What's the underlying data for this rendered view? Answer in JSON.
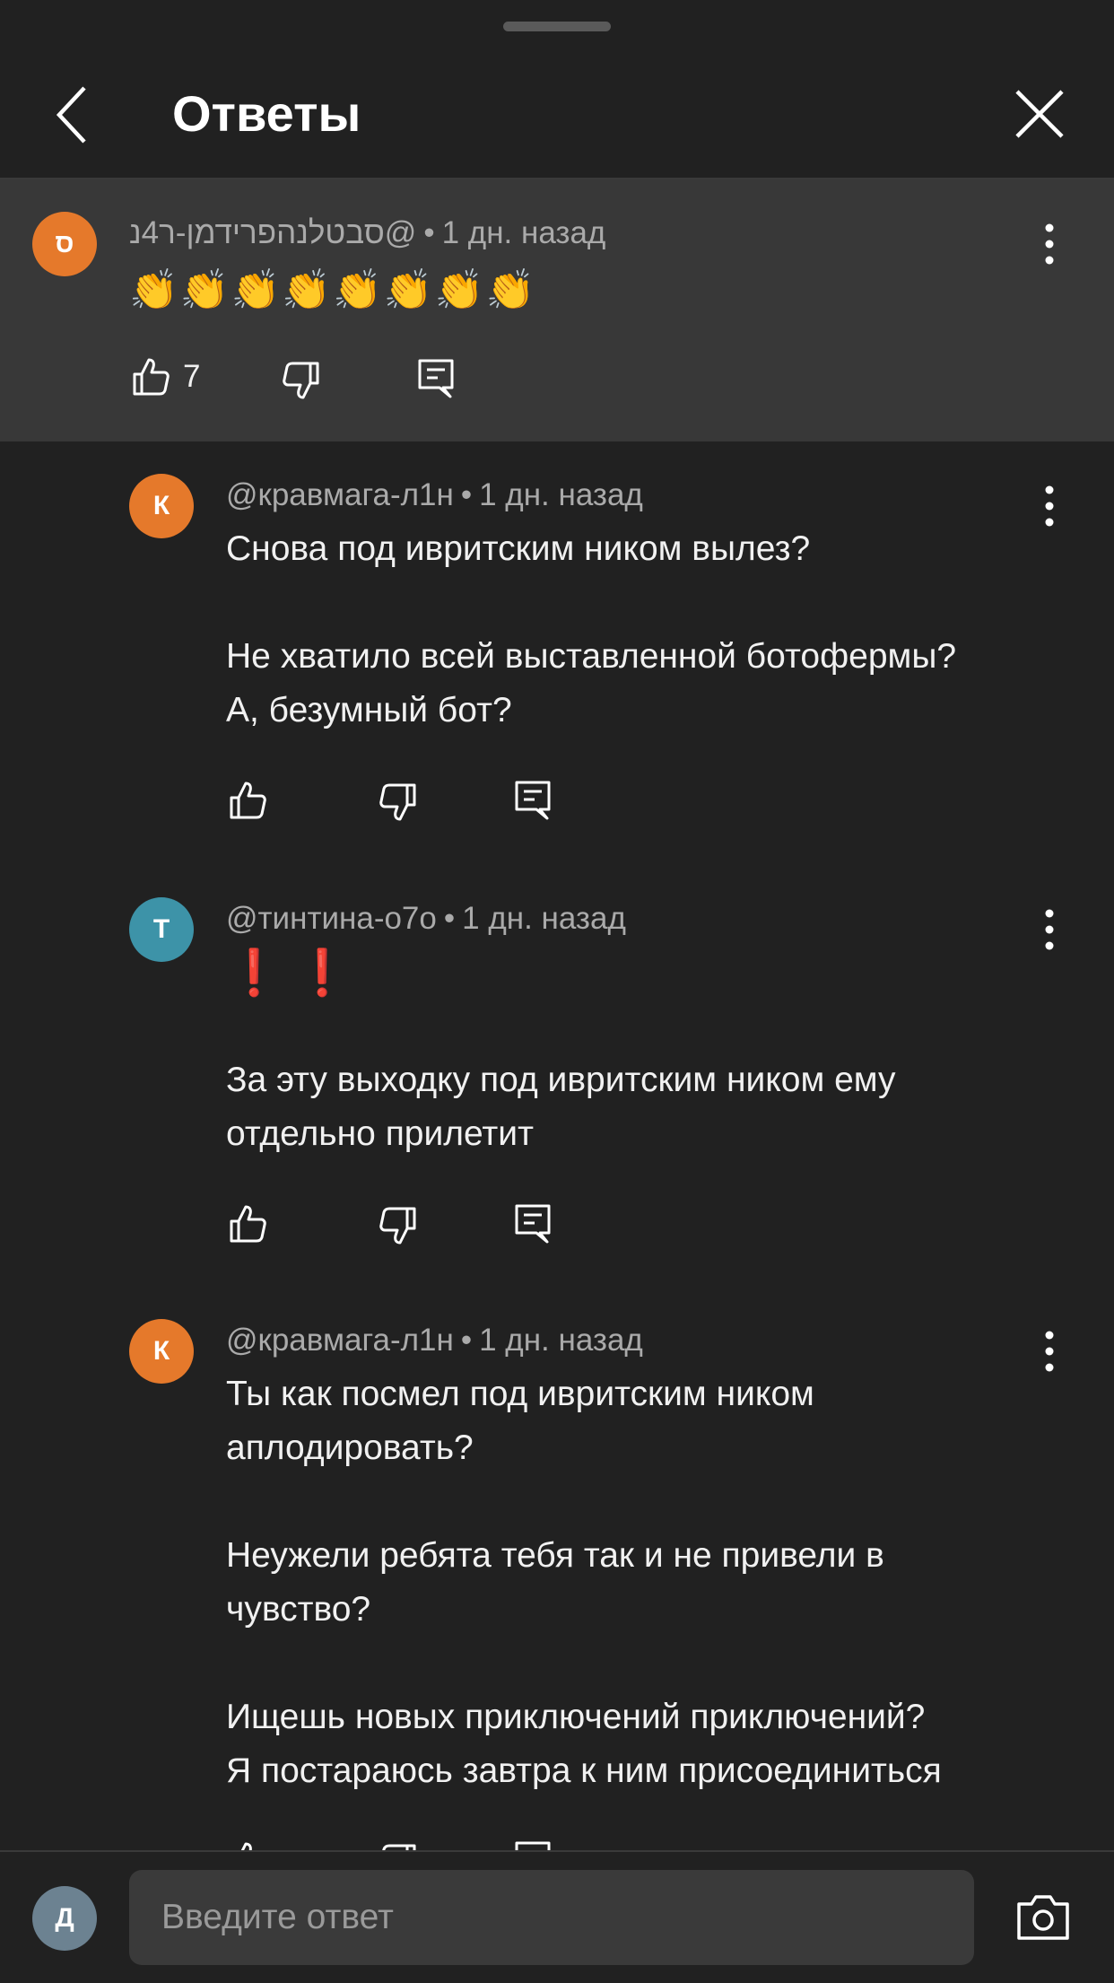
{
  "header": {
    "title": "Ответы"
  },
  "parent": {
    "avatar_letter": "ס",
    "avatar_color": "#e5792b",
    "author": "@סבטלנהפרידמן-ר4נ",
    "time": "1 дн. назад",
    "emojis": "👏👏👏👏👏👏👏👏",
    "likes": "7"
  },
  "replies": [
    {
      "avatar_letter": "К",
      "avatar_color": "#e5792b",
      "author": "@кравмага-л1н",
      "time": "1 дн. назад",
      "text": "Снова под ивритским ником вылез?\n\nНе хватило всей выставленной ботофермы?\nА, безумный бот?"
    },
    {
      "avatar_letter": "Т",
      "avatar_color": "#3d93a8",
      "author": "@тинтина-о7о",
      "time": "1 дн. назад",
      "marks": "❗ ❗",
      "text": "За эту выходку под ивритским ником ему\nотдельно прилетит"
    },
    {
      "avatar_letter": "К",
      "avatar_color": "#e5792b",
      "author": "@кравмага-л1н",
      "time": "1 дн. назад",
      "text": "Ты как посмел под ивритским ником\nаплодировать?\n\nНеужели ребята тебя так и не привели в\nчувство?\n\nИщешь новых приключений приключений?\nЯ постараюсь завтра к ним присоединиться"
    }
  ],
  "reply_bar": {
    "avatar_letter": "Д",
    "avatar_color": "#6c8291",
    "placeholder": "Введите ответ"
  }
}
